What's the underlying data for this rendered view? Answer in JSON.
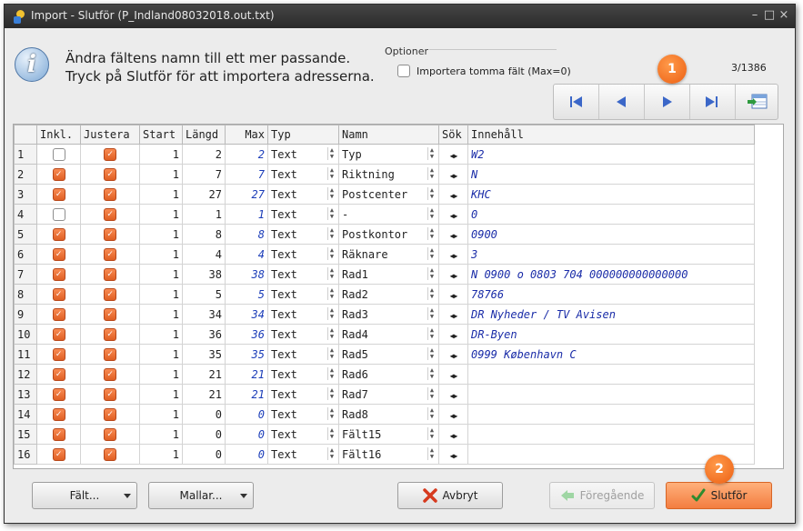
{
  "window": {
    "title": "Import - Slutför  (P_Indland08032018.out.txt)"
  },
  "header": {
    "message_line1": "Ändra fältens namn till ett mer passande.",
    "message_line2": "Tryck på Slutför för att importera adresserna.",
    "options_legend": "Optioner",
    "option_empty_fields": "Importera tomma fält (Max=0)",
    "option_empty_fields_checked": false,
    "page_count": "3/1386"
  },
  "nav": {
    "buttons": [
      "first-record-icon",
      "previous-record-icon",
      "next-record-icon",
      "last-record-icon",
      "import-table-icon"
    ]
  },
  "badges": {
    "one": "1",
    "two": "2"
  },
  "table": {
    "columns": [
      "",
      "Inkl.",
      "Justera",
      "Start",
      "Längd",
      "Max",
      "Typ",
      "Namn",
      "Sök",
      "Innehåll"
    ],
    "rows": [
      {
        "n": "1",
        "inkl": false,
        "justera": true,
        "start": "1",
        "langd": "2",
        "max": "2",
        "typ": "Text",
        "namn": "Typ",
        "innehall": "W2"
      },
      {
        "n": "2",
        "inkl": true,
        "justera": true,
        "start": "1",
        "langd": "7",
        "max": "7",
        "typ": "Text",
        "namn": "Riktning",
        "innehall": "N"
      },
      {
        "n": "3",
        "inkl": true,
        "justera": true,
        "start": "1",
        "langd": "27",
        "max": "27",
        "typ": "Text",
        "namn": "Postcenter",
        "innehall": "KHC"
      },
      {
        "n": "4",
        "inkl": false,
        "justera": true,
        "start": "1",
        "langd": "1",
        "max": "1",
        "typ": "Text",
        "namn": "-",
        "innehall": "0"
      },
      {
        "n": "5",
        "inkl": true,
        "justera": true,
        "start": "1",
        "langd": "8",
        "max": "8",
        "typ": "Text",
        "namn": "Postkontor",
        "innehall": "0900"
      },
      {
        "n": "6",
        "inkl": true,
        "justera": true,
        "start": "1",
        "langd": "4",
        "max": "4",
        "typ": "Text",
        "namn": "Räknare",
        "innehall": "3"
      },
      {
        "n": "7",
        "inkl": true,
        "justera": true,
        "start": "1",
        "langd": "38",
        "max": "38",
        "typ": "Text",
        "namn": "Rad1",
        "innehall": "N  0900  o  0803  704  000000000000000"
      },
      {
        "n": "8",
        "inkl": true,
        "justera": true,
        "start": "1",
        "langd": "5",
        "max": "5",
        "typ": "Text",
        "namn": "Rad2",
        "innehall": "78766"
      },
      {
        "n": "9",
        "inkl": true,
        "justera": true,
        "start": "1",
        "langd": "34",
        "max": "34",
        "typ": "Text",
        "namn": "Rad3",
        "innehall": "DR Nyheder / TV Avisen"
      },
      {
        "n": "10",
        "inkl": true,
        "justera": true,
        "start": "1",
        "langd": "36",
        "max": "36",
        "typ": "Text",
        "namn": "Rad4",
        "innehall": "DR-Byen"
      },
      {
        "n": "11",
        "inkl": true,
        "justera": true,
        "start": "1",
        "langd": "35",
        "max": "35",
        "typ": "Text",
        "namn": "Rad5",
        "innehall": "0999  København C"
      },
      {
        "n": "12",
        "inkl": true,
        "justera": true,
        "start": "1",
        "langd": "21",
        "max": "21",
        "typ": "Text",
        "namn": "Rad6",
        "innehall": ""
      },
      {
        "n": "13",
        "inkl": true,
        "justera": true,
        "start": "1",
        "langd": "21",
        "max": "21",
        "typ": "Text",
        "namn": "Rad7",
        "innehall": ""
      },
      {
        "n": "14",
        "inkl": true,
        "justera": true,
        "start": "1",
        "langd": "0",
        "max": "0",
        "typ": "Text",
        "namn": "Rad8",
        "innehall": ""
      },
      {
        "n": "15",
        "inkl": true,
        "justera": true,
        "start": "1",
        "langd": "0",
        "max": "0",
        "typ": "Text",
        "namn": "Fält15",
        "innehall": ""
      },
      {
        "n": "16",
        "inkl": true,
        "justera": true,
        "start": "1",
        "langd": "0",
        "max": "0",
        "typ": "Text",
        "namn": "Fält16",
        "innehall": ""
      }
    ]
  },
  "footer": {
    "falt_label": "Fält...",
    "mallar_label": "Mallar...",
    "avbryt_label": "Avbryt",
    "foregaende_label": "Föregående",
    "slutfor_label": "Slutför"
  },
  "colors": {
    "accent": "#f37d40",
    "content_text": "#1a2ca8",
    "titlebar": "#353535"
  }
}
